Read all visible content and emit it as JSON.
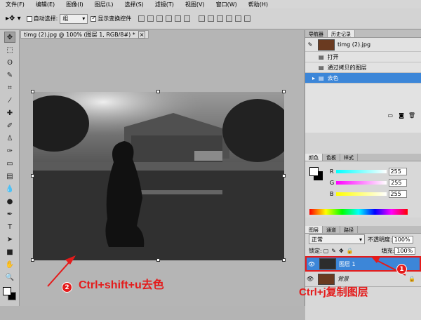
{
  "menu": [
    "文件(F)",
    "编辑(E)",
    "图像(I)",
    "图层(L)",
    "选择(S)",
    "滤镜(T)",
    "视图(V)",
    "窗口(W)",
    "帮助(H)"
  ],
  "options": {
    "auto_select_label": "自动选择:",
    "auto_select_value": "组",
    "show_transform_label": "显示变换控件"
  },
  "document": {
    "tab_title": "timg (2).jpg @ 100% (图层 1, RGB/8#) *"
  },
  "history_panel": {
    "tabs": [
      "导航器",
      "历史记录"
    ],
    "snapshot_name": "timg (2).jpg",
    "items": [
      {
        "label": "打开",
        "selected": false
      },
      {
        "label": "通过拷贝的图层",
        "selected": false
      },
      {
        "label": "去色",
        "selected": true
      }
    ]
  },
  "color_panel": {
    "tabs": [
      "颜色",
      "色板",
      "样式"
    ],
    "channels": [
      {
        "label": "R",
        "value": "255",
        "color": "#ff4040"
      },
      {
        "label": "G",
        "value": "255",
        "color": "#40c040"
      },
      {
        "label": "B",
        "value": "255",
        "color": "#4040ff"
      }
    ]
  },
  "layers_panel": {
    "tabs": [
      "图层",
      "通道",
      "路径"
    ],
    "blend_mode": "正常",
    "opacity_label": "不透明度:",
    "opacity_value": "100%",
    "lock_label": "锁定:",
    "fill_label": "填充:",
    "fill_value": "100%",
    "layers": [
      {
        "name": "图层 1",
        "selected": true
      },
      {
        "name": "背景",
        "selected": false
      }
    ]
  },
  "annotations": {
    "badge1": "1",
    "badge2": "2",
    "text1": "Ctrl+j复制图层",
    "text2": "Ctrl+shift+u去色",
    "color": "#e41b1b"
  }
}
